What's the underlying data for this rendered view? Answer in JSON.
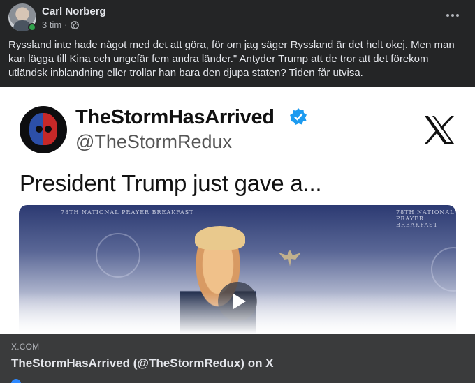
{
  "post": {
    "author": "Carl Norberg",
    "time": "3 tim",
    "separator": "·",
    "privacy_icon": "globe-icon",
    "more_icon": "more-options-icon",
    "text": "Ryssland inte hade något med det att göra, för om jag säger Ryssland är det helt okej. Men man kan lägga till Kina och ungefär fem andra länder.\" Antyder Trump att de tror att det förekom utländsk inblandning eller trollar han bara den djupa staten? Tiden får utvisa."
  },
  "embed": {
    "display_name": "TheStormHasArrived",
    "handle": "@TheStormRedux",
    "headline": "President Trump just gave a...",
    "verified_icon": "verified-badge-icon",
    "platform_icon": "x-logo-icon",
    "play_icon": "play-icon",
    "banner_text": "78TH NATIONAL PRAYER BREAKFAST"
  },
  "link": {
    "domain": "X.COM",
    "title": "TheStormHasArrived (@TheStormRedux) on X"
  },
  "colors": {
    "background": "#242526",
    "link_panel": "#3a3b3c",
    "online": "#31a24c",
    "verified": "#1d9bf0"
  }
}
